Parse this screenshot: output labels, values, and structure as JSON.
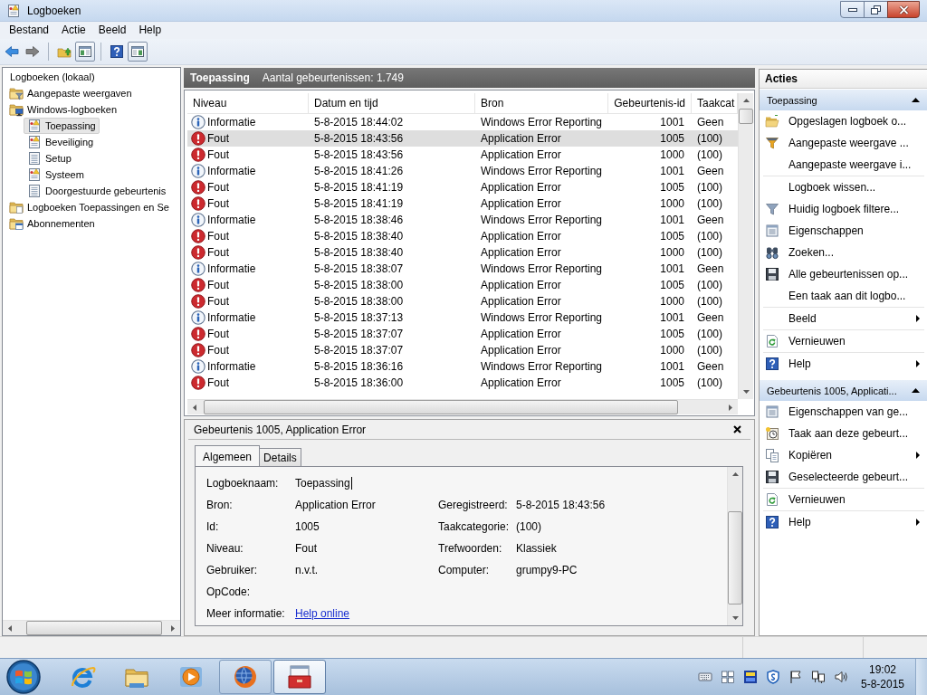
{
  "window": {
    "title": "Logboeken"
  },
  "menu": [
    {
      "label": "Bestand"
    },
    {
      "label": "Actie"
    },
    {
      "label": "Beeld"
    },
    {
      "label": "Help"
    }
  ],
  "toolbar": [
    {
      "kind": "back",
      "disabled": false,
      "pressed": false
    },
    {
      "kind": "forward",
      "disabled": true,
      "pressed": false
    },
    {
      "kind": "separator"
    },
    {
      "kind": "up",
      "disabled": false,
      "pressed": false
    },
    {
      "kind": "tree",
      "disabled": false,
      "pressed": true
    },
    {
      "kind": "separator"
    },
    {
      "kind": "help",
      "disabled": false,
      "pressed": false
    },
    {
      "kind": "actionpane",
      "disabled": false,
      "pressed": true
    }
  ],
  "tree": [
    {
      "label": "Logboeken (lokaal)",
      "selected": false,
      "children": [
        {
          "label": "Aangepaste weergaven",
          "kind": "filterfolder",
          "selected": false
        },
        {
          "label": "Windows-logboeken",
          "kind": "computerfolder",
          "selected": false,
          "children": [
            {
              "label": "Toepassing",
              "kind": "log",
              "selected": true
            },
            {
              "label": "Beveiliging",
              "kind": "log",
              "selected": false
            },
            {
              "label": "Setup",
              "kind": "plainlog",
              "selected": false
            },
            {
              "label": "Systeem",
              "kind": "log",
              "selected": false
            },
            {
              "label": "Doorgestuurde gebeurtenis",
              "kind": "plainlog",
              "selected": false
            }
          ]
        },
        {
          "label": "Logboeken Toepassingen en Se",
          "kind": "folder",
          "selected": false
        },
        {
          "label": "Abonnementen",
          "kind": "subscriptions",
          "selected": false
        }
      ]
    }
  ],
  "events": {
    "title": "Toepassing",
    "count": "Aantal gebeurtenissen: 1.749",
    "columns": [
      "Niveau",
      "Datum en tijd",
      "Bron",
      "Gebeurtenis-id",
      "Taakcat"
    ],
    "rows": [
      {
        "kind": "info",
        "selected": false,
        "cells": [
          "Informatie",
          "5-8-2015 18:44:02",
          "Windows Error Reporting",
          "1001",
          "Geen"
        ]
      },
      {
        "kind": "error",
        "selected": true,
        "cells": [
          "Fout",
          "5-8-2015 18:43:56",
          "Application Error",
          "1005",
          "(100)"
        ]
      },
      {
        "kind": "error",
        "selected": false,
        "cells": [
          "Fout",
          "5-8-2015 18:43:56",
          "Application Error",
          "1000",
          "(100)"
        ]
      },
      {
        "kind": "info",
        "selected": false,
        "cells": [
          "Informatie",
          "5-8-2015 18:41:26",
          "Windows Error Reporting",
          "1001",
          "Geen"
        ]
      },
      {
        "kind": "error",
        "selected": false,
        "cells": [
          "Fout",
          "5-8-2015 18:41:19",
          "Application Error",
          "1005",
          "(100)"
        ]
      },
      {
        "kind": "error",
        "selected": false,
        "cells": [
          "Fout",
          "5-8-2015 18:41:19",
          "Application Error",
          "1000",
          "(100)"
        ]
      },
      {
        "kind": "info",
        "selected": false,
        "cells": [
          "Informatie",
          "5-8-2015 18:38:46",
          "Windows Error Reporting",
          "1001",
          "Geen"
        ]
      },
      {
        "kind": "error",
        "selected": false,
        "cells": [
          "Fout",
          "5-8-2015 18:38:40",
          "Application Error",
          "1005",
          "(100)"
        ]
      },
      {
        "kind": "error",
        "selected": false,
        "cells": [
          "Fout",
          "5-8-2015 18:38:40",
          "Application Error",
          "1000",
          "(100)"
        ]
      },
      {
        "kind": "info",
        "selected": false,
        "cells": [
          "Informatie",
          "5-8-2015 18:38:07",
          "Windows Error Reporting",
          "1001",
          "Geen"
        ]
      },
      {
        "kind": "error",
        "selected": false,
        "cells": [
          "Fout",
          "5-8-2015 18:38:00",
          "Application Error",
          "1005",
          "(100)"
        ]
      },
      {
        "kind": "error",
        "selected": false,
        "cells": [
          "Fout",
          "5-8-2015 18:38:00",
          "Application Error",
          "1000",
          "(100)"
        ]
      },
      {
        "kind": "info",
        "selected": false,
        "cells": [
          "Informatie",
          "5-8-2015 18:37:13",
          "Windows Error Reporting",
          "1001",
          "Geen"
        ]
      },
      {
        "kind": "error",
        "selected": false,
        "cells": [
          "Fout",
          "5-8-2015 18:37:07",
          "Application Error",
          "1005",
          "(100)"
        ]
      },
      {
        "kind": "error",
        "selected": false,
        "cells": [
          "Fout",
          "5-8-2015 18:37:07",
          "Application Error",
          "1000",
          "(100)"
        ]
      },
      {
        "kind": "info",
        "selected": false,
        "cells": [
          "Informatie",
          "5-8-2015 18:36:16",
          "Windows Error Reporting",
          "1001",
          "Geen"
        ]
      },
      {
        "kind": "error",
        "selected": false,
        "cells": [
          "Fout",
          "5-8-2015 18:36:00",
          "Application Error",
          "1005",
          "(100)"
        ]
      }
    ]
  },
  "detail": {
    "title": "Gebeurtenis 1005, Application Error",
    "tabs": [
      {
        "label": "Algemeen",
        "selected": true
      },
      {
        "label": "Details",
        "selected": false
      }
    ],
    "fields": [
      {
        "label": "Logboeknaam:",
        "value": "Toepassing",
        "cursor": true
      },
      {
        "label": "Bron:",
        "value": "Application Error",
        "label_2": "Geregistreerd:",
        "value_2": "5-8-2015 18:43:56",
        "cursor": false
      },
      {
        "label": "Id:",
        "value": "1005",
        "label_2": "Taakcategorie:",
        "value_2": "(100)",
        "cursor": false
      },
      {
        "label": "Niveau:",
        "value": "Fout",
        "label_2": "Trefwoorden:",
        "value_2": "Klassiek",
        "cursor": false
      },
      {
        "label": "Gebruiker:",
        "value": "n.v.t.",
        "label_2": "Computer:",
        "value_2": "grumpy9-PC",
        "cursor": false
      },
      {
        "label": "OpCode:"
      },
      {
        "label": "Meer informatie:",
        "link": "Help online"
      }
    ]
  },
  "actions": {
    "title": "Acties",
    "sections": [
      {
        "title": "Toepassing",
        "expanded": true,
        "groups": [
          [
            {
              "label": "Opgeslagen logboek o...",
              "kind": "open",
              "submenu": false
            },
            {
              "label": "Aangepaste weergave ...",
              "kind": "newfilter",
              "submenu": false
            },
            {
              "label": "Aangepaste weergave i...",
              "kind": "plain",
              "submenu": false
            }
          ],
          [
            {
              "label": "Logboek wissen...",
              "kind": "plain",
              "submenu": false
            },
            {
              "label": "Huidig logboek filtere...",
              "kind": "filter",
              "submenu": false
            },
            {
              "label": "Eigenschappen",
              "kind": "properties",
              "submenu": false
            },
            {
              "label": "Zoeken...",
              "kind": "find",
              "submenu": false
            },
            {
              "label": "Alle gebeurtenissen op...",
              "kind": "save",
              "submenu": false
            },
            {
              "label": "Een taak aan dit logbo...",
              "kind": "plain",
              "submenu": false
            }
          ],
          [
            {
              "label": "Beeld",
              "kind": "plain",
              "submenu": true
            }
          ],
          [
            {
              "label": "Vernieuwen",
              "kind": "refresh",
              "submenu": false
            }
          ],
          [
            {
              "label": "Help",
              "kind": "help",
              "submenu": true
            }
          ]
        ]
      },
      {
        "title": "Gebeurtenis 1005, Applicati...",
        "expanded": true,
        "groups": [
          [
            {
              "label": "Eigenschappen van ge...",
              "kind": "properties",
              "submenu": false
            },
            {
              "label": "Taak aan deze gebeurt...",
              "kind": "task",
              "submenu": false
            },
            {
              "label": "Kopiëren",
              "kind": "copy",
              "submenu": true
            },
            {
              "label": "Geselecteerde gebeurt...",
              "kind": "save",
              "submenu": false
            }
          ],
          [
            {
              "label": "Vernieuwen",
              "kind": "refresh",
              "submenu": false
            }
          ],
          [
            {
              "label": "Help",
              "kind": "help",
              "submenu": true
            }
          ]
        ]
      }
    ]
  },
  "taskbar": {
    "apps": [
      {
        "kind": "browser",
        "running": false,
        "active": false
      },
      {
        "kind": "explorer",
        "running": false,
        "active": false
      },
      {
        "kind": "player",
        "running": false,
        "active": false
      },
      {
        "kind": "firefox",
        "running": true,
        "active": false
      },
      {
        "kind": "toolbox",
        "running": true,
        "active": true
      }
    ],
    "tray": [
      {
        "kind": "keyboard"
      },
      {
        "kind": "squares"
      },
      {
        "kind": "tile"
      },
      {
        "kind": "shield"
      },
      {
        "kind": "flag"
      },
      {
        "kind": "network"
      },
      {
        "kind": "speaker"
      }
    ],
    "clock": {
      "time": "19:02",
      "date": "5-8-2015"
    }
  }
}
